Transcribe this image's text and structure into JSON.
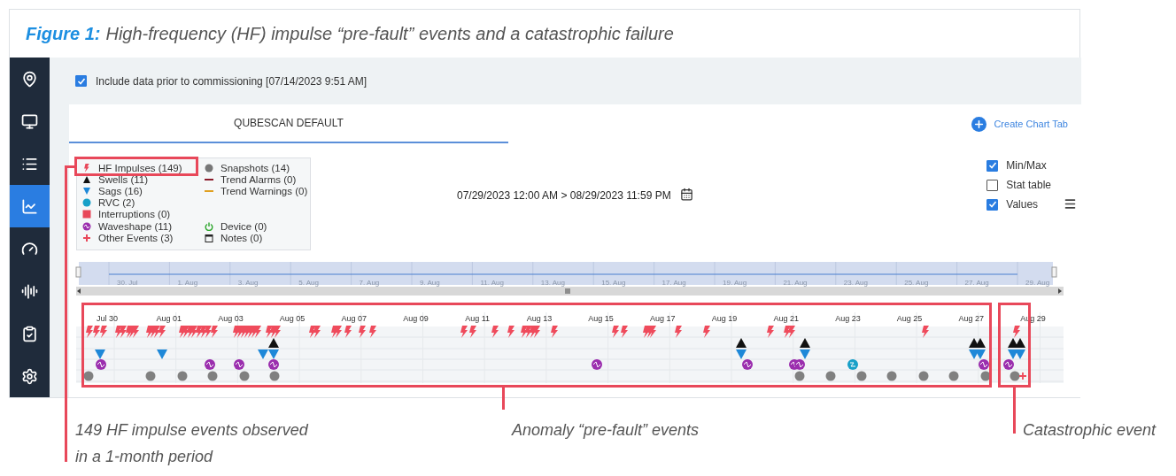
{
  "figure": {
    "label": "Figure 1:",
    "title": "High-frequency (HF) impulse “pre-fault” events and a catastrophic failure"
  },
  "sidebar": {
    "items": [
      {
        "kind": "location",
        "selected": false
      },
      {
        "kind": "monitor",
        "selected": false
      },
      {
        "kind": "list",
        "selected": false
      },
      {
        "kind": "chart",
        "selected": true
      },
      {
        "kind": "gauge",
        "selected": false
      },
      {
        "kind": "waveform",
        "selected": false
      },
      {
        "kind": "clipboard",
        "selected": false
      },
      {
        "kind": "settings",
        "selected": false
      }
    ]
  },
  "include_prior": {
    "label": "Include data prior to commissioning [07/14/2023 9:51 AM]",
    "checked": true
  },
  "tabs": [
    {
      "label": "QUBESCAN DEFAULT",
      "selected": true
    }
  ],
  "create_tab": "Create Chart Tab",
  "legend": {
    "columns": [
      [
        {
          "kind": "hf",
          "label": "HF Impulses (149)"
        },
        {
          "kind": "swell",
          "label": "Swells (11)"
        },
        {
          "kind": "sag",
          "label": "Sags (16)"
        },
        {
          "kind": "rvc",
          "label": "RVC (2)"
        },
        {
          "kind": "interruption",
          "label": "Interruptions (0)"
        },
        {
          "kind": "waveshape",
          "label": "Waveshape (11)"
        },
        {
          "kind": "other",
          "label": "Other Events (3)"
        }
      ],
      [
        {
          "kind": "snapshot",
          "label": "Snapshots (14)"
        },
        {
          "kind": "trend_alarm",
          "label": "Trend Alarms (0)"
        },
        {
          "kind": "trend_warning",
          "label": "Trend Warnings (0)"
        }
      ],
      [
        {
          "kind": "device",
          "label": "Device (0)"
        },
        {
          "kind": "notes",
          "label": "Notes (0)"
        }
      ]
    ]
  },
  "date_range": "07/29/2023 12:00 AM > 08/29/2023 11:59 PM",
  "options": [
    {
      "label": "Min/Max",
      "checked": true
    },
    {
      "label": "Stat table",
      "checked": false
    },
    {
      "label": "Values",
      "checked": true
    }
  ],
  "navigator": {
    "labels": [
      "30. Jul",
      "1. Aug",
      "3. Aug",
      "5. Aug",
      "7. Aug",
      "9. Aug",
      "11. Aug",
      "13. Aug",
      "15. Aug",
      "17. Aug",
      "19. Aug",
      "21. Aug",
      "23. Aug",
      "25. Aug",
      "27. Aug",
      "29. Aug"
    ]
  },
  "timeline": {
    "labels": [
      "Jul 30",
      "Aug 01",
      "Aug 03",
      "Aug 05",
      "Aug 07",
      "Aug 09",
      "Aug 11",
      "Aug 13",
      "Aug 15",
      "Aug 17",
      "Aug 19",
      "Aug 21",
      "Aug 23",
      "Aug 25",
      "Aug 27",
      "Aug 29"
    ]
  },
  "annotations": [
    {
      "text": "149 HF impulse events observed in a 1-month period"
    },
    {
      "text": "Anomaly “pre-fault” events"
    },
    {
      "text": "Catastrophic event"
    }
  ]
}
